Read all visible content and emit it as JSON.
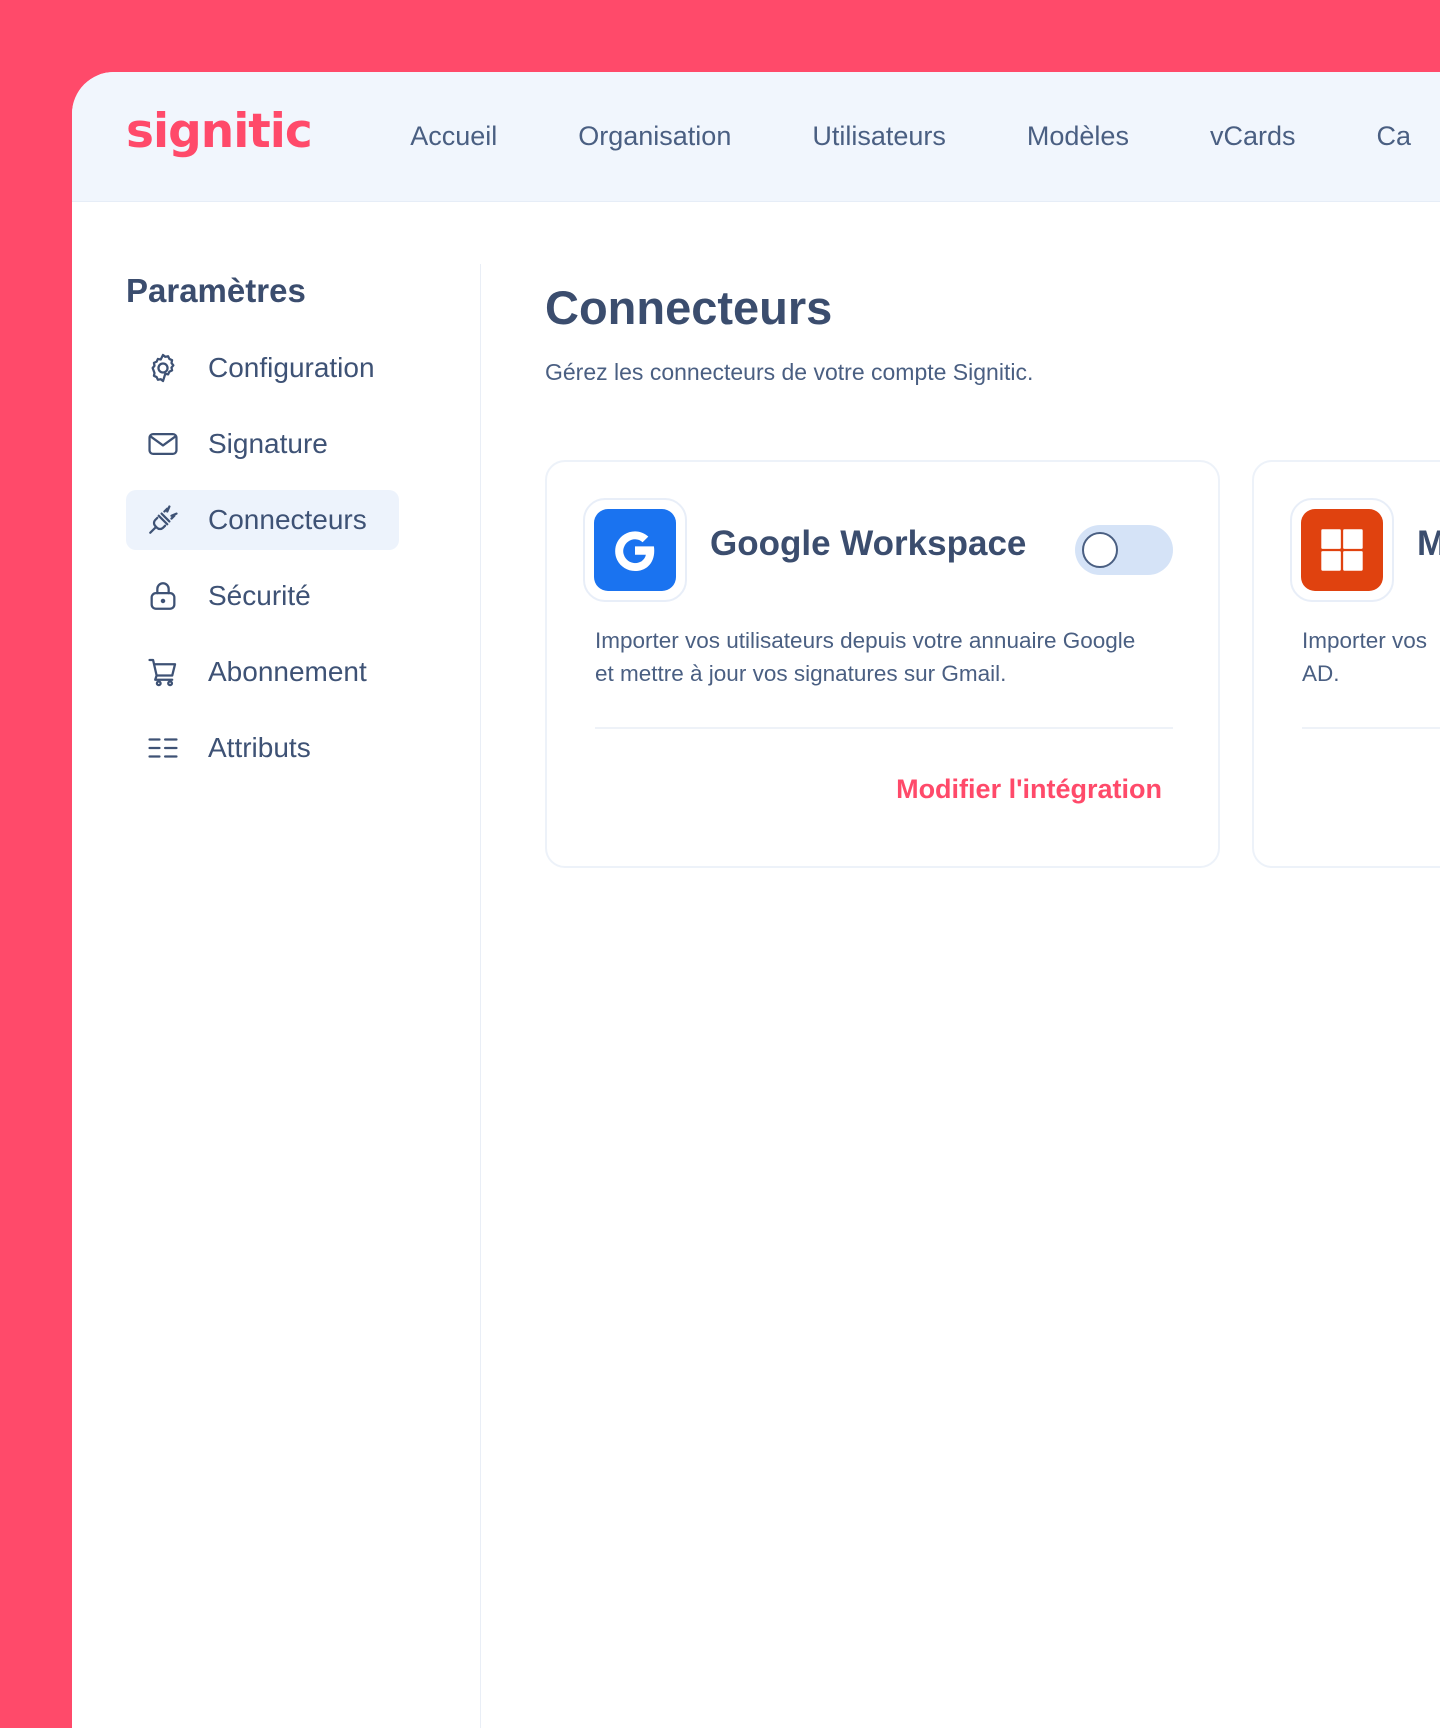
{
  "app": {
    "logo_text": "signitic"
  },
  "nav": {
    "items": [
      {
        "label": "Accueil"
      },
      {
        "label": "Organisation"
      },
      {
        "label": "Utilisateurs"
      },
      {
        "label": "Modèles"
      },
      {
        "label": "vCards"
      },
      {
        "label": "Ca"
      }
    ]
  },
  "sidebar": {
    "title": "Paramètres",
    "items": [
      {
        "label": "Configuration",
        "icon": "gear-icon"
      },
      {
        "label": "Signature",
        "icon": "envelope-icon"
      },
      {
        "label": "Connecteurs",
        "icon": "plug-icon",
        "active": true
      },
      {
        "label": "Sécurité",
        "icon": "lock-icon"
      },
      {
        "label": "Abonnement",
        "icon": "cart-icon"
      },
      {
        "label": "Attributs",
        "icon": "list-icon"
      }
    ]
  },
  "main": {
    "title": "Connecteurs",
    "subtitle": "Gérez les connecteurs de votre compte Signitic."
  },
  "cards": [
    {
      "name": "Google Workspace",
      "icon": "google-icon",
      "icon_letter": "G",
      "icon_color": "#1a73f0",
      "enabled": false,
      "description": "Importer vos utilisateurs depuis votre annuaire Google et mettre à jour vos signatures sur Gmail.",
      "action_label": "Modifier l'intégration"
    },
    {
      "name": "M",
      "icon": "microsoft-icon",
      "icon_color": "#e0420f",
      "description": "Importer vos\nAD."
    }
  ],
  "colors": {
    "brand": "#ff4a6a",
    "text": "#3f5272",
    "topbar_bg": "#f1f6fd"
  }
}
